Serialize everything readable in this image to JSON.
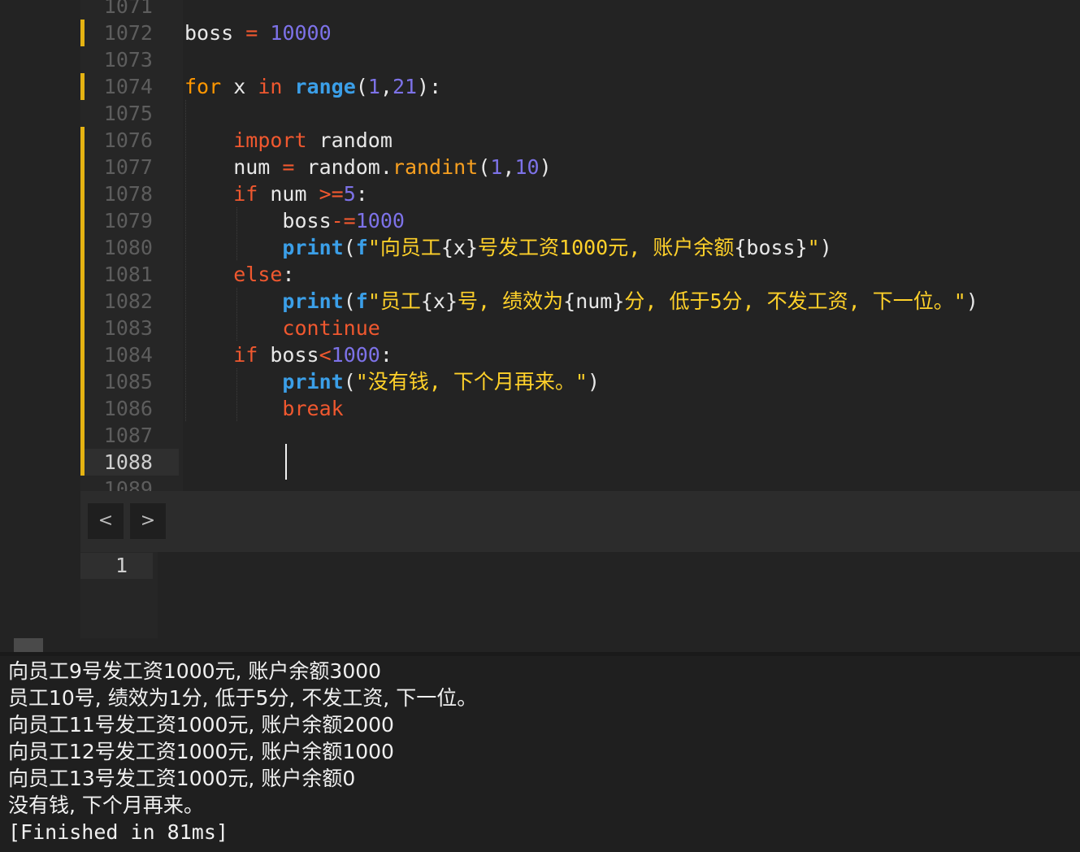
{
  "editor": {
    "top_partial_line_number": "1071",
    "bottom_partial_line_number": "1089",
    "lines": [
      {
        "num": "1072",
        "tokens": [
          [
            "pl",
            "boss "
          ],
          [
            "op",
            "="
          ],
          [
            "pl",
            " "
          ],
          [
            "num",
            "10000"
          ]
        ]
      },
      {
        "num": "1073",
        "tokens": []
      },
      {
        "num": "1074",
        "tokens": [
          [
            "kw2",
            "for"
          ],
          [
            "pl",
            " x "
          ],
          [
            "kw",
            "in"
          ],
          [
            "pl",
            " "
          ],
          [
            "bi",
            "range"
          ],
          [
            "pl",
            "("
          ],
          [
            "num",
            "1"
          ],
          [
            "pl",
            ","
          ],
          [
            "num",
            "21"
          ],
          [
            "pl",
            "):"
          ]
        ]
      },
      {
        "num": "1075",
        "tokens": []
      },
      {
        "num": "1076",
        "tokens": [
          [
            "pl",
            "    "
          ],
          [
            "kw",
            "import"
          ],
          [
            "pl",
            " random"
          ]
        ]
      },
      {
        "num": "1077",
        "tokens": [
          [
            "pl",
            "    num "
          ],
          [
            "op",
            "="
          ],
          [
            "pl",
            " random."
          ],
          [
            "fn",
            "randint"
          ],
          [
            "pl",
            "("
          ],
          [
            "num",
            "1"
          ],
          [
            "pl",
            ","
          ],
          [
            "num",
            "10"
          ],
          [
            "pl",
            ")"
          ]
        ]
      },
      {
        "num": "1078",
        "tokens": [
          [
            "pl",
            "    "
          ],
          [
            "kw",
            "if"
          ],
          [
            "pl",
            " num "
          ],
          [
            "op",
            ">="
          ],
          [
            "num",
            "5"
          ],
          [
            "pl",
            ":"
          ]
        ]
      },
      {
        "num": "1079",
        "tokens": [
          [
            "pl",
            "        boss"
          ],
          [
            "op",
            "-="
          ],
          [
            "num",
            "1000"
          ]
        ]
      },
      {
        "num": "1080",
        "tokens": [
          [
            "pl",
            "        "
          ],
          [
            "bi",
            "print"
          ],
          [
            "pl",
            "("
          ],
          [
            "bi",
            "f"
          ],
          [
            "str",
            "\"向员工"
          ],
          [
            "pl",
            "{x}"
          ],
          [
            "str",
            "号发工资1000元, 账户余额"
          ],
          [
            "pl",
            "{boss}"
          ],
          [
            "str",
            "\""
          ],
          [
            "pl",
            ")"
          ]
        ]
      },
      {
        "num": "1081",
        "tokens": [
          [
            "pl",
            "    "
          ],
          [
            "kw",
            "else"
          ],
          [
            "pl",
            ":"
          ]
        ]
      },
      {
        "num": "1082",
        "tokens": [
          [
            "pl",
            "        "
          ],
          [
            "bi",
            "print"
          ],
          [
            "pl",
            "("
          ],
          [
            "bi",
            "f"
          ],
          [
            "str",
            "\"员工"
          ],
          [
            "pl",
            "{x}"
          ],
          [
            "str",
            "号, 绩效为"
          ],
          [
            "pl",
            "{num}"
          ],
          [
            "str",
            "分, 低于5分, 不发工资, 下一位。\""
          ],
          [
            "pl",
            ")"
          ]
        ]
      },
      {
        "num": "1083",
        "tokens": [
          [
            "pl",
            "        "
          ],
          [
            "kw",
            "continue"
          ]
        ]
      },
      {
        "num": "1084",
        "tokens": [
          [
            "pl",
            "    "
          ],
          [
            "kw",
            "if"
          ],
          [
            "pl",
            " boss"
          ],
          [
            "op",
            "<"
          ],
          [
            "num",
            "1000"
          ],
          [
            "pl",
            ":"
          ]
        ]
      },
      {
        "num": "1085",
        "tokens": [
          [
            "pl",
            "        "
          ],
          [
            "bi",
            "print"
          ],
          [
            "pl",
            "("
          ],
          [
            "str",
            "\"没有钱, 下个月再来。\""
          ],
          [
            "pl",
            ")"
          ]
        ]
      },
      {
        "num": "1086",
        "tokens": [
          [
            "pl",
            "        "
          ],
          [
            "kw",
            "break"
          ]
        ]
      },
      {
        "num": "1087",
        "tokens": []
      },
      {
        "num": "1088",
        "tokens": []
      }
    ],
    "modified_lines": [
      "1072",
      "1074",
      "1076",
      "1077",
      "1078",
      "1079",
      "1080",
      "1081",
      "1082",
      "1083",
      "1084",
      "1085",
      "1086",
      "1087",
      "1088"
    ],
    "current_line": "1088"
  },
  "nav": {
    "prev": "<",
    "next": ">"
  },
  "pane2": {
    "line_number": "1"
  },
  "console": {
    "lines": [
      "向员工9号发工资1000元, 账户余额3000",
      "员工10号, 绩效为1分, 低于5分, 不发工资, 下一位。",
      "向员工11号发工资1000元, 账户余额2000",
      "向员工12号发工资1000元, 账户余额1000",
      "向员工13号发工资1000元, 账户余额0",
      "没有钱, 下个月再来。",
      "[Finished in 81ms]"
    ]
  },
  "colors": {
    "modified_marker": "#e5b312",
    "keyword": "#f0582f",
    "for_keyword": "#ff9700",
    "number": "#7d72e8",
    "builtin": "#3b9fe8",
    "string": "#ffd12a"
  }
}
